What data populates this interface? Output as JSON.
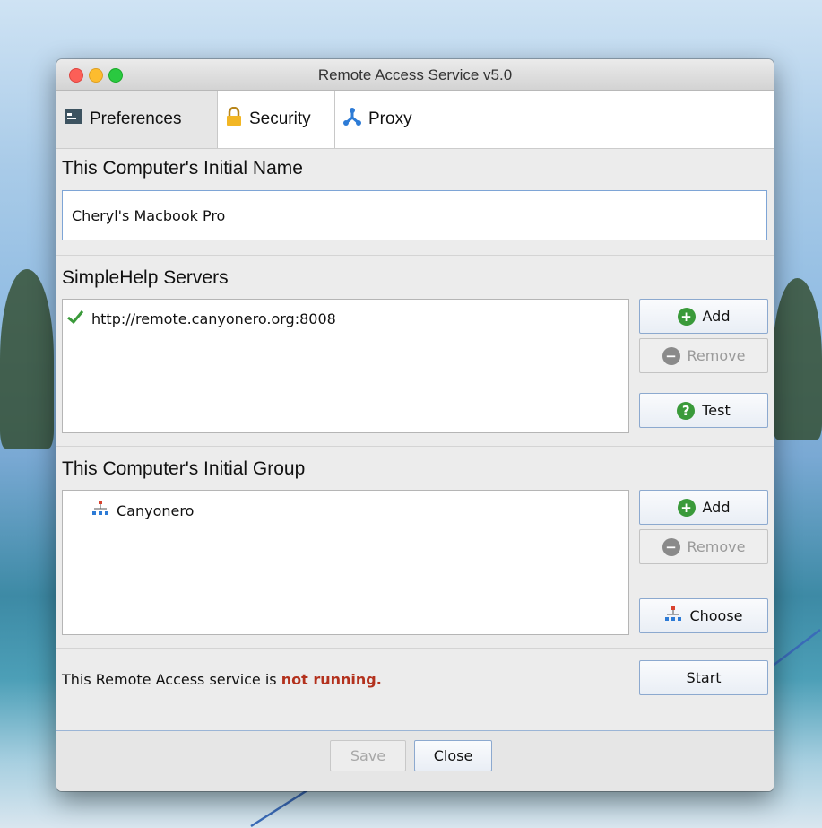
{
  "window": {
    "title": "Remote Access Service v5.0"
  },
  "tabs": [
    {
      "label": "Preferences",
      "icon": "preferences-icon"
    },
    {
      "label": "Security",
      "icon": "lock-icon"
    },
    {
      "label": "Proxy",
      "icon": "proxy-icon"
    }
  ],
  "name_section": {
    "title": "This Computer's Initial Name",
    "value": "Cheryl's Macbook Pro"
  },
  "servers_section": {
    "title": "SimpleHelp Servers",
    "items": [
      {
        "label": "http://remote.canyonero.org:8008",
        "status": "checkmark"
      }
    ],
    "buttons": {
      "add": "Add",
      "remove": "Remove",
      "test": "Test"
    }
  },
  "group_section": {
    "title": "This Computer's Initial Group",
    "items": [
      {
        "label": "Canyonero",
        "icon": "group-tree-icon"
      }
    ],
    "buttons": {
      "add": "Add",
      "remove": "Remove",
      "choose": "Choose"
    }
  },
  "service": {
    "status_prefix": "This Remote Access service is",
    "status_value": "not running.",
    "start_label": "Start"
  },
  "footer": {
    "save_label": "Save",
    "close_label": "Close"
  },
  "colors": {
    "accent": "#7ea5d6",
    "warning": "#b3311d",
    "success": "#3a9a3a"
  }
}
